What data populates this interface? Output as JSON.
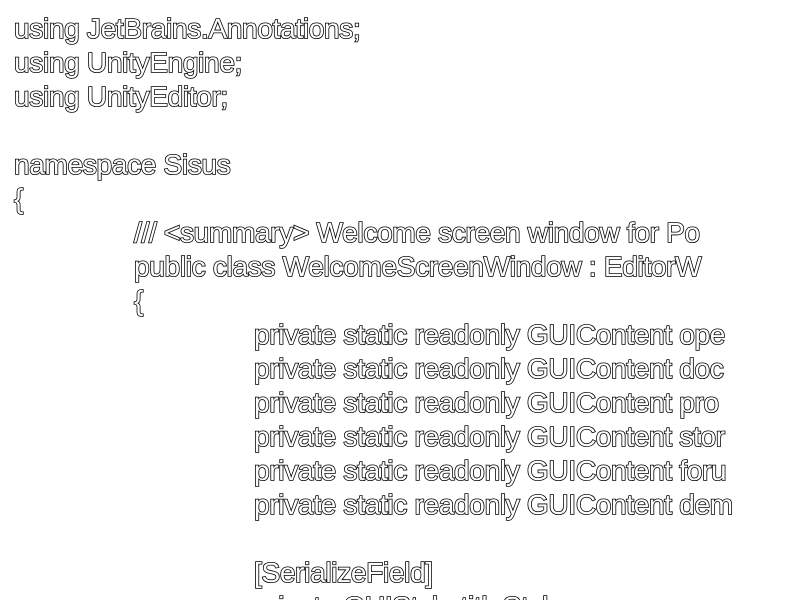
{
  "editor": {
    "lines": [
      {
        "text": "using JetBrains.Annotations;"
      },
      {
        "text": "using UnityEngine;"
      },
      {
        "text": "using UnityEditor;"
      },
      {
        "text": ""
      },
      {
        "text": "namespace Sisus"
      },
      {
        "text": "{"
      },
      {
        "text": "/// <summary> Welcome screen window for Po"
      },
      {
        "text": "public class WelcomeScreenWindow : EditorW"
      },
      {
        "text": "{"
      },
      {
        "text": "private static readonly GUIContent ope"
      },
      {
        "text": "private static readonly GUIContent doc"
      },
      {
        "text": "private static readonly GUIContent pro"
      },
      {
        "text": "private static readonly GUIContent stor"
      },
      {
        "text": "private static readonly GUIContent foru"
      },
      {
        "text": "private static readonly GUIContent dem"
      },
      {
        "text": ""
      },
      {
        "text": "[SerializeField]"
      },
      {
        "text": "private GUIStyle titleStyle;"
      }
    ]
  }
}
